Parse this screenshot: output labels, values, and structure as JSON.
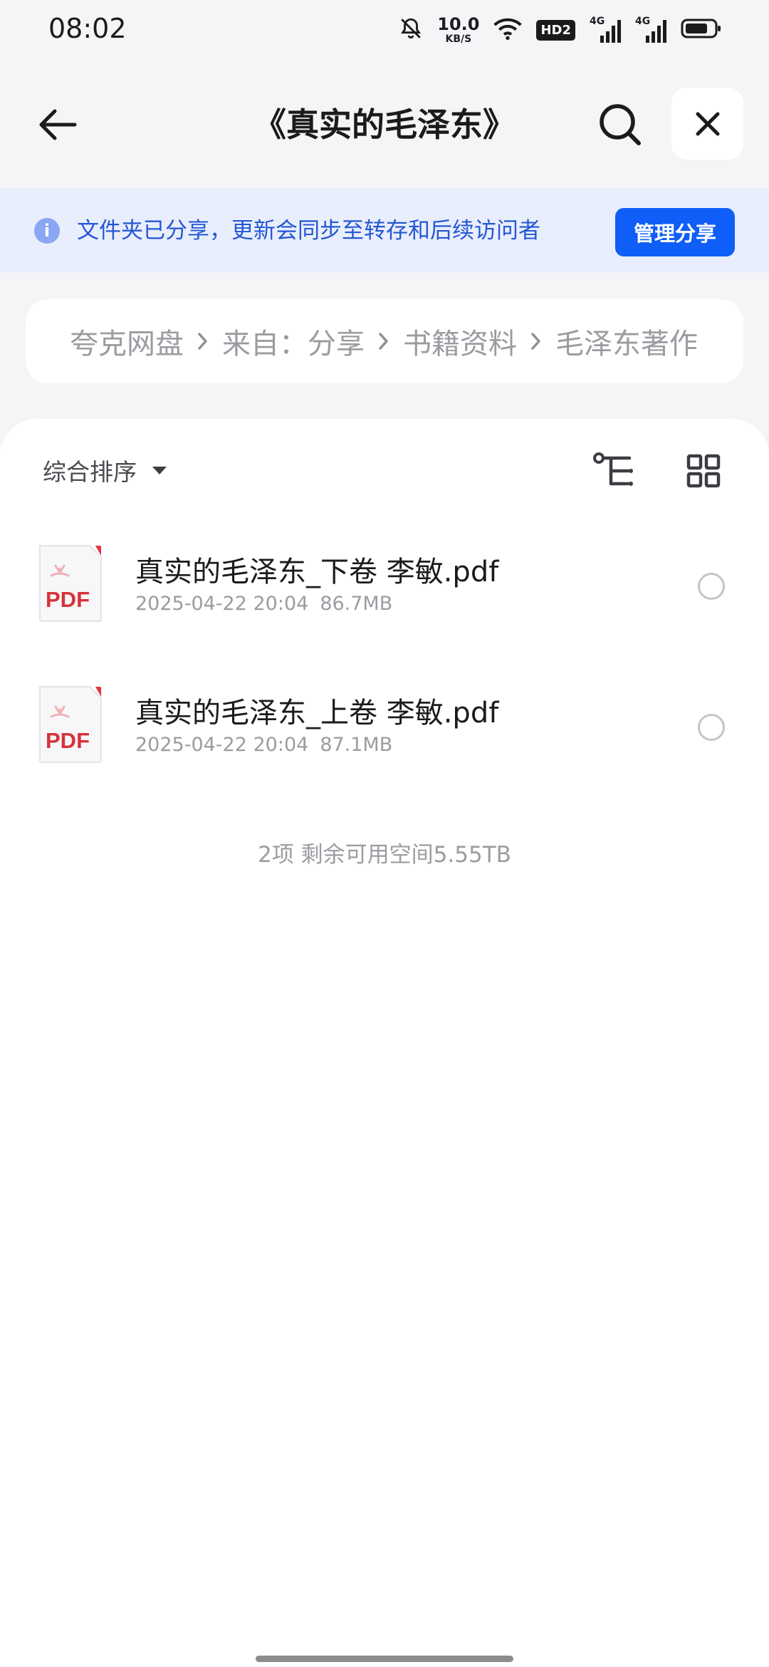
{
  "status_bar": {
    "time": "08:02",
    "net_speed_value": "10.0",
    "net_speed_unit": "KB/S",
    "hd_badge": "HD2",
    "signal_1_label": "4G",
    "signal_2_label": "4G",
    "icons": [
      "bell-off-icon",
      "wifi-icon",
      "battery-icon"
    ]
  },
  "header": {
    "title": "《真实的毛泽东》",
    "icons": [
      "back-arrow-icon",
      "search-icon",
      "close-icon"
    ]
  },
  "banner": {
    "info_glyph": "i",
    "text": "文件夹已分享，更新会同步至转存和后续访问者",
    "manage_label": "管理分享"
  },
  "breadcrumb": {
    "items": [
      "夸克网盘",
      "来自：分享",
      "书籍资料",
      "毛泽东著作"
    ]
  },
  "toolbar": {
    "sort_label": "综合排序",
    "icons": [
      "tree-view-icon",
      "grid-view-icon"
    ]
  },
  "files": [
    {
      "name": "真实的毛泽东_下卷 李敏.pdf",
      "date": "2025-04-22 20:04",
      "size": "86.7MB",
      "type_label": "PDF"
    },
    {
      "name": "真实的毛泽东_上卷 李敏.pdf",
      "date": "2025-04-22 20:04",
      "size": "87.1MB",
      "type_label": "PDF"
    }
  ],
  "footer": {
    "summary": "2项 剩余可用空间5.55TB"
  },
  "colors": {
    "accent": "#0f5ef7",
    "banner_bg": "#e9eefc",
    "banner_text": "#2457d4",
    "pdf_red": "#d6323a"
  }
}
